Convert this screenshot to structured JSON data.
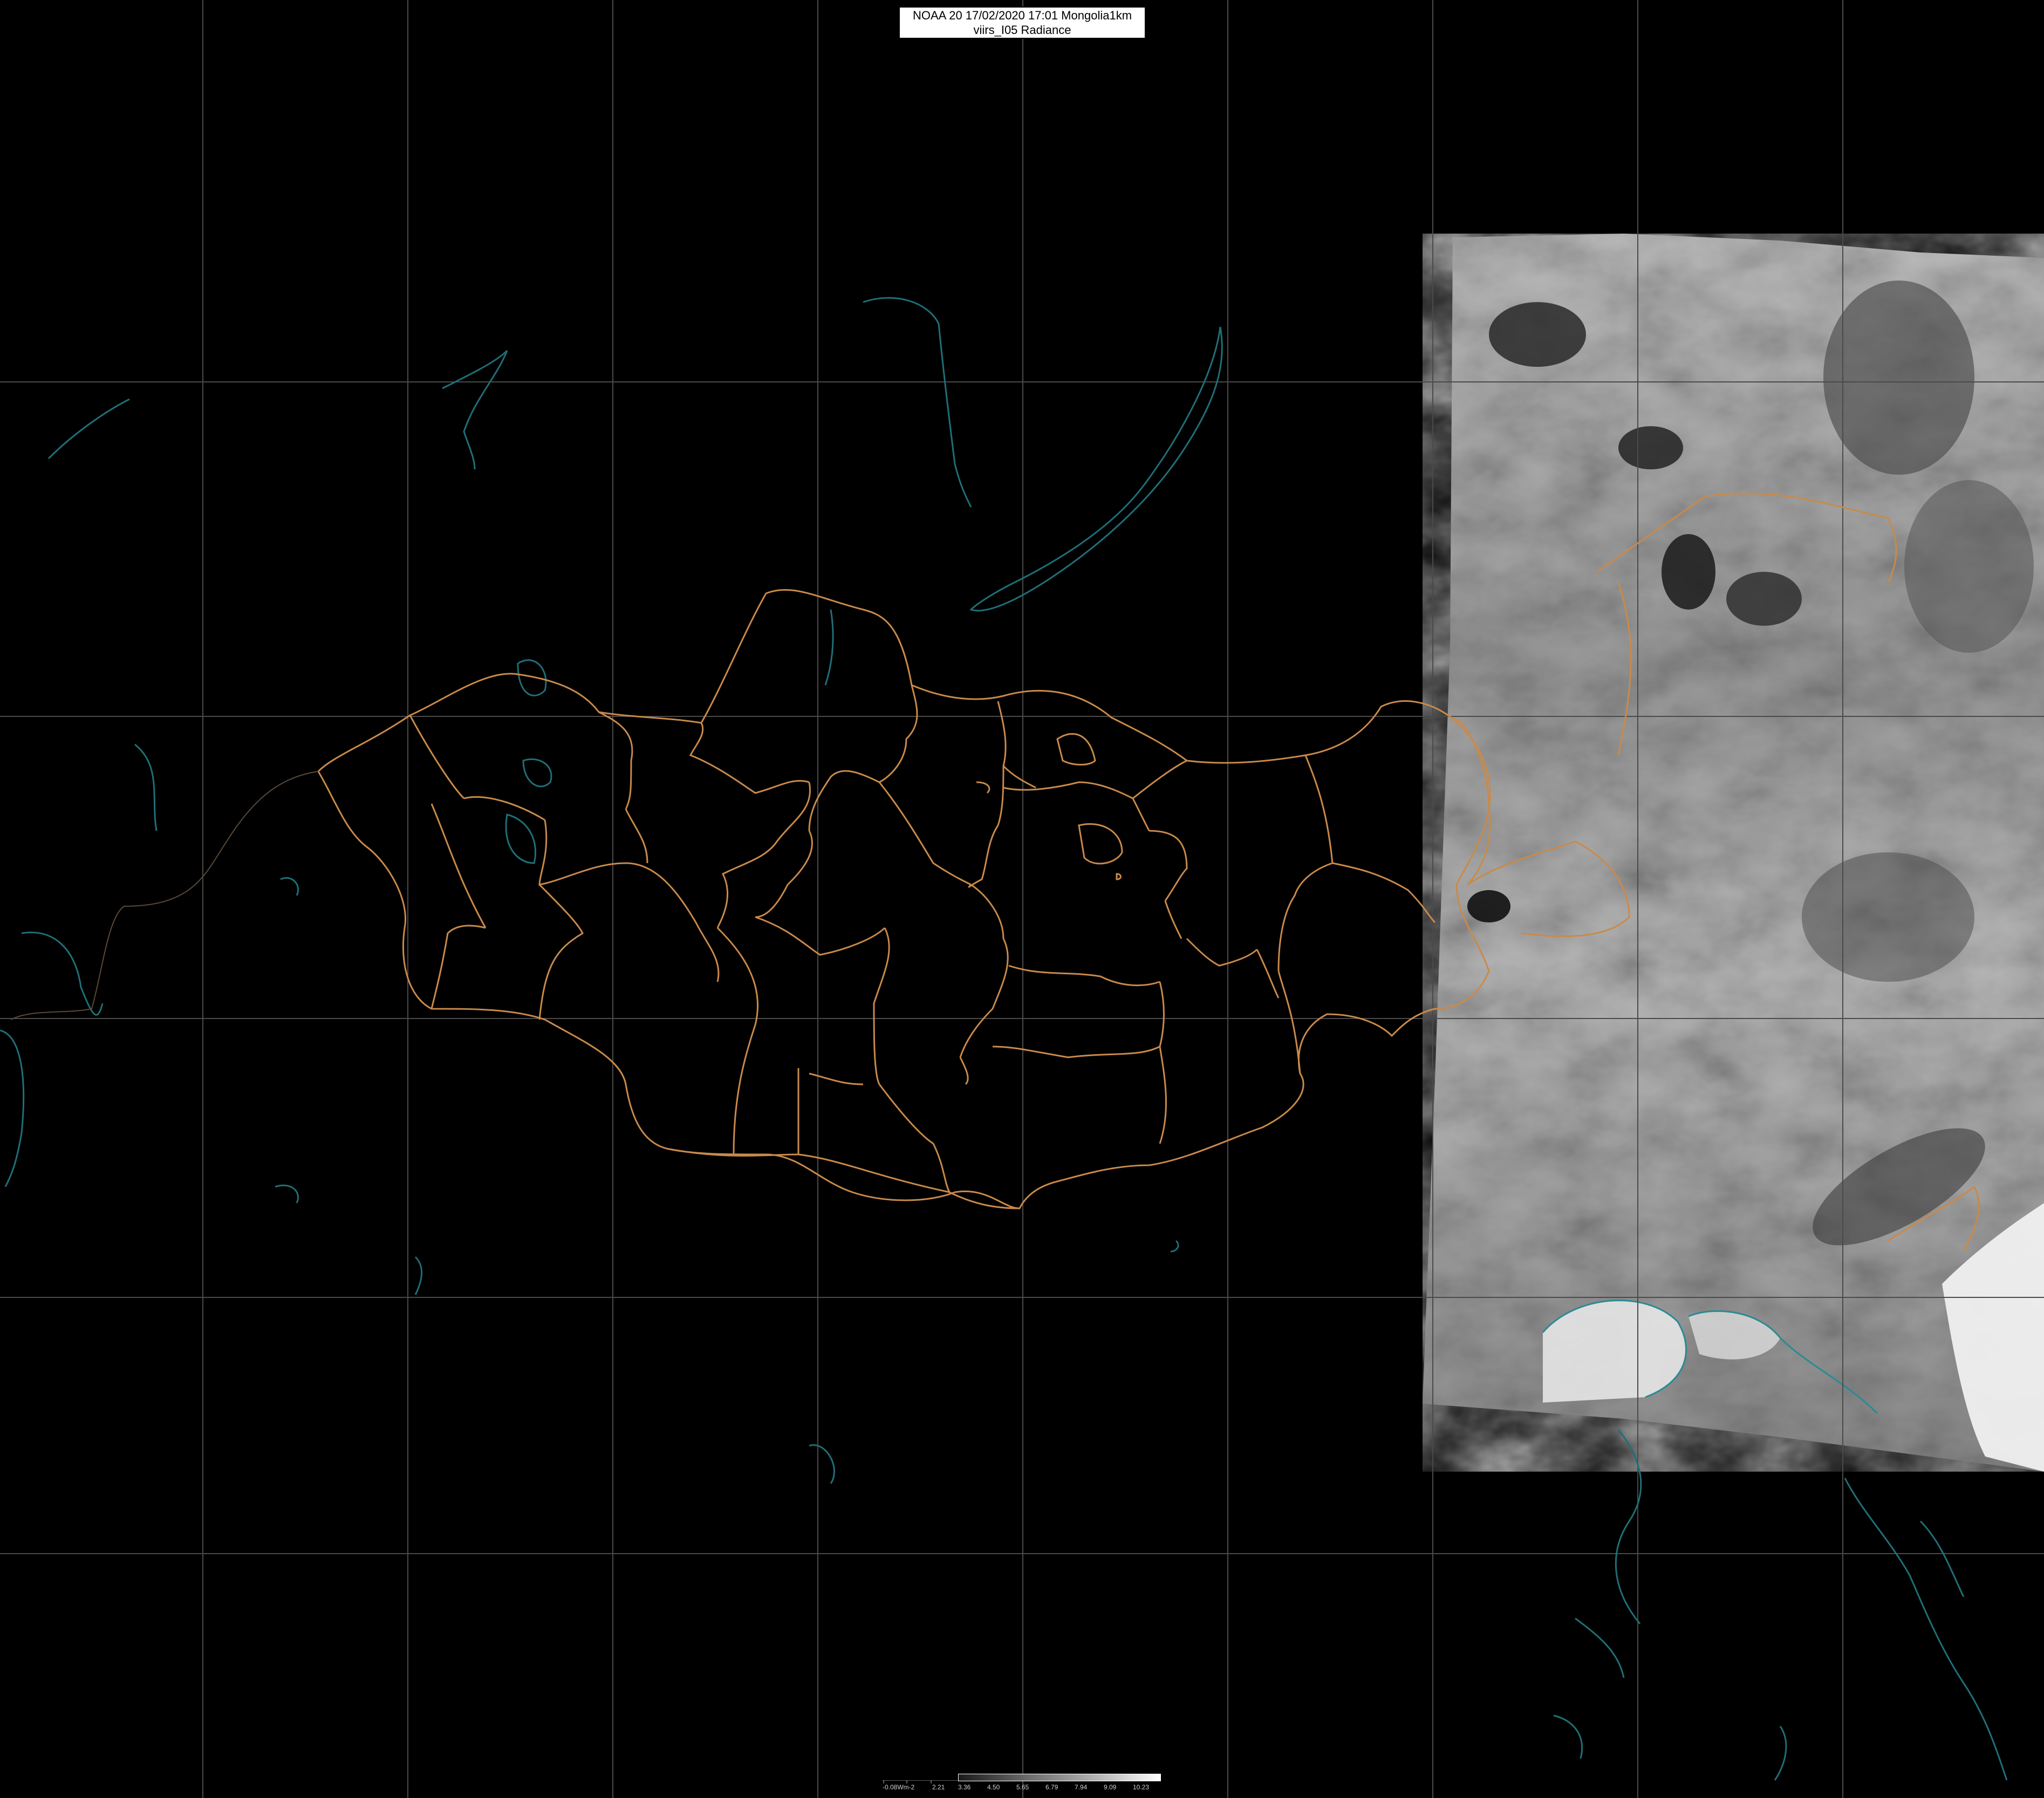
{
  "title": {
    "line1": "NOAA 20 17/02/2020 17:01 Mongolia1km",
    "line2": "viirs_I05 Radiance"
  },
  "legend": {
    "unit_label": "-0.08Wm-2",
    "ticks": [
      "2.21",
      "3.36",
      "4.50",
      "5.65",
      "6.79",
      "7.94",
      "9.09",
      "10.23"
    ]
  },
  "colors": {
    "background": "#000000",
    "graticule": "#4a4a4a",
    "admin_border": "#c98a4a",
    "water_coast": "#1f6f78",
    "swath_light": "#d8d8d8",
    "swath_dark": "#3a3a3a"
  }
}
